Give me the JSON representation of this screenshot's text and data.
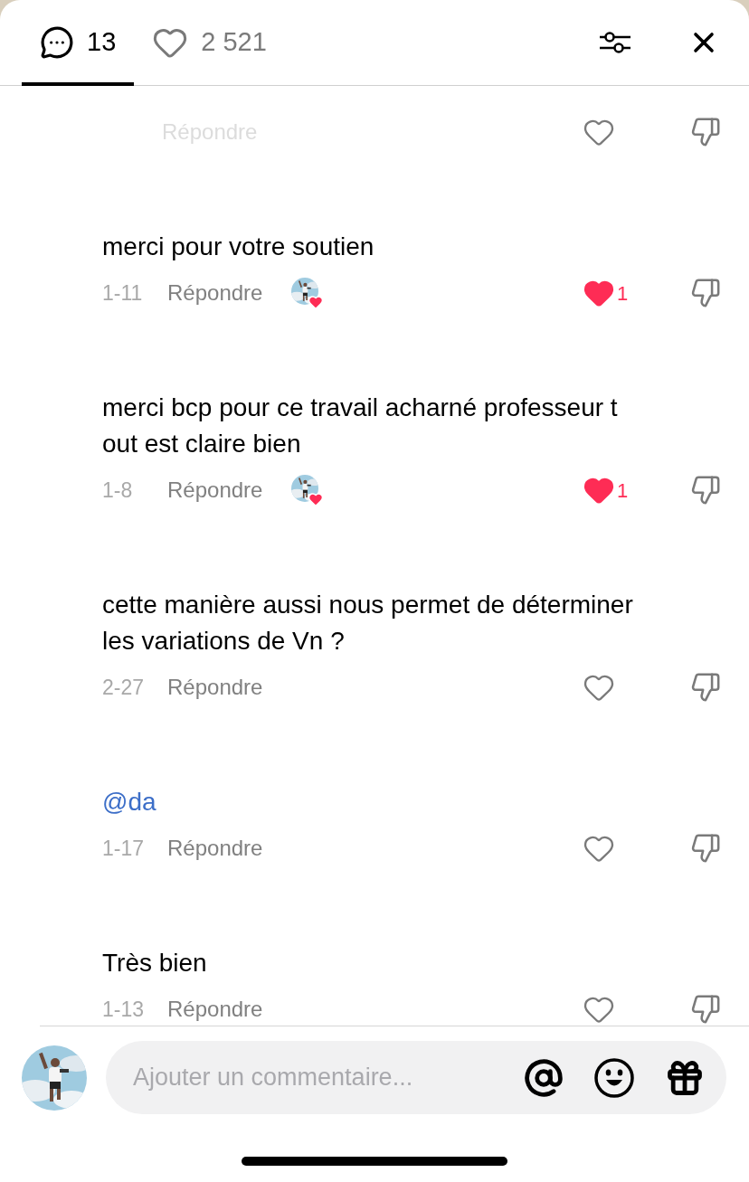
{
  "header": {
    "tabs": [
      {
        "kind": "comments",
        "label": "13",
        "selected": true
      },
      {
        "kind": "likes",
        "label": "2 521",
        "selected": false
      }
    ]
  },
  "comments": [
    {
      "partial": true,
      "faded": true,
      "reply": "Répondre",
      "liked": false
    },
    {
      "lines": [
        "merci pour votre soutien"
      ],
      "date": "1-11",
      "reply": "Répondre",
      "creator_liked": true,
      "liked": true,
      "likes": "1"
    },
    {
      "lines": [
        "merci bcp pour ce travail acharné professeur t",
        "out est claire bien"
      ],
      "date": "1-8",
      "reply": "Répondre",
      "creator_liked": true,
      "liked": true,
      "likes": "1"
    },
    {
      "lines": [
        "cette manière aussi nous permet de déterminer",
        "les variations de Vn ?"
      ],
      "date": "2-27",
      "reply": "Répondre",
      "creator_liked": false,
      "liked": false
    },
    {
      "mention": "@da",
      "date": "1-17",
      "reply": "Répondre",
      "creator_liked": false,
      "liked": false
    },
    {
      "lines": [
        "Très bien"
      ],
      "date": "1-13",
      "reply": "Répondre",
      "creator_liked": false,
      "liked": false
    }
  ],
  "composer": {
    "placeholder": "Ajouter un commentaire..."
  }
}
